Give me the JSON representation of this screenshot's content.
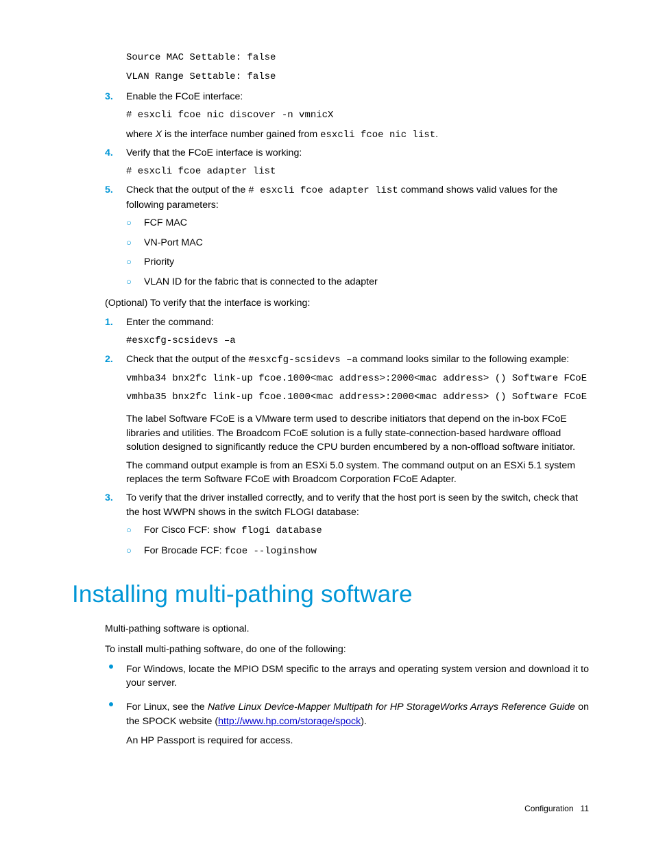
{
  "code_top1": "Source MAC Settable: false",
  "code_top2": "VLAN Range Settable: false",
  "s3": {
    "n": "3.",
    "text": "Enable the FCoE interface:",
    "code": "# esxcli fcoe nic discover -n vmnicX",
    "where_a": "where ",
    "where_x": "X",
    "where_b": " is the interface number gained from ",
    "where_code": "esxcli fcoe nic list",
    "where_dot": "."
  },
  "s4": {
    "n": "4.",
    "text": "Verify that the FCoE interface is working:",
    "code": "# esxcli fcoe adapter list"
  },
  "s5": {
    "n": "5.",
    "a": "Check that the output of the ",
    "code": "# esxcli fcoe adapter list",
    "b": " command shows valid values for the following parameters:",
    "li1": "FCF MAC",
    "li2": "VN-Port MAC",
    "li3": "Priority",
    "li4": "VLAN ID for the fabric that is connected to the adapter"
  },
  "optional": "(Optional) To verify that the interface is working:",
  "v1": {
    "n": "1.",
    "text": "Enter the command:",
    "code": "#esxcfg-scsidevs –a"
  },
  "v2": {
    "n": "2.",
    "a": "Check that the output of the ",
    "code": "#esxcfg-scsidevs –a",
    "b": " command looks similar to the following example:",
    "ex1": "vmhba34 bnx2fc link-up fcoe.1000<mac address>:2000<mac address> () Software FCoE",
    "ex2": "vmhba35 bnx2fc link-up fcoe.1000<mac address>:2000<mac address> () Software FCoE",
    "para1": "The label Software FCoE is a VMware term used to describe initiators that depend on the in-box FCoE libraries and utilities. The Broadcom FCoE solution is a fully state-connection-based hardware offload solution designed to significantly reduce the CPU burden encumbered by a non-offload software initiator.",
    "para2": "The command output example is from an ESXi 5.0 system. The command output on an ESXi 5.1 system replaces the term Software FCoE with Broadcom Corporation FCoE Adapter."
  },
  "v3": {
    "n": "3.",
    "text": "To verify that the driver installed correctly, and to verify that the host port is seen by the switch, check that the host WWPN shows in the switch FLOGI database:",
    "ca": "For Cisco FCF: ",
    "ccode": "show flogi database",
    "ba": "For Brocade FCF: ",
    "bcode": "fcoe --loginshow"
  },
  "heading": "Installing multi-pathing software",
  "mp1": "Multi-pathing software is optional.",
  "mp2": "To install multi-pathing software, do one of the following:",
  "bw": "For Windows, locate the MPIO DSM specific to the arrays and operating system version and download it to your server.",
  "bl": {
    "a": "For Linux, see the ",
    "ital": "Native Linux Device-Mapper Multipath for HP StorageWorks Arrays Reference Guide",
    "b": " on the SPOCK website (",
    "link": "http://www.hp.com/storage/spock",
    "c": ").",
    "p2": "An HP Passport is required for access."
  },
  "footer_a": "Configuration",
  "footer_b": "11"
}
